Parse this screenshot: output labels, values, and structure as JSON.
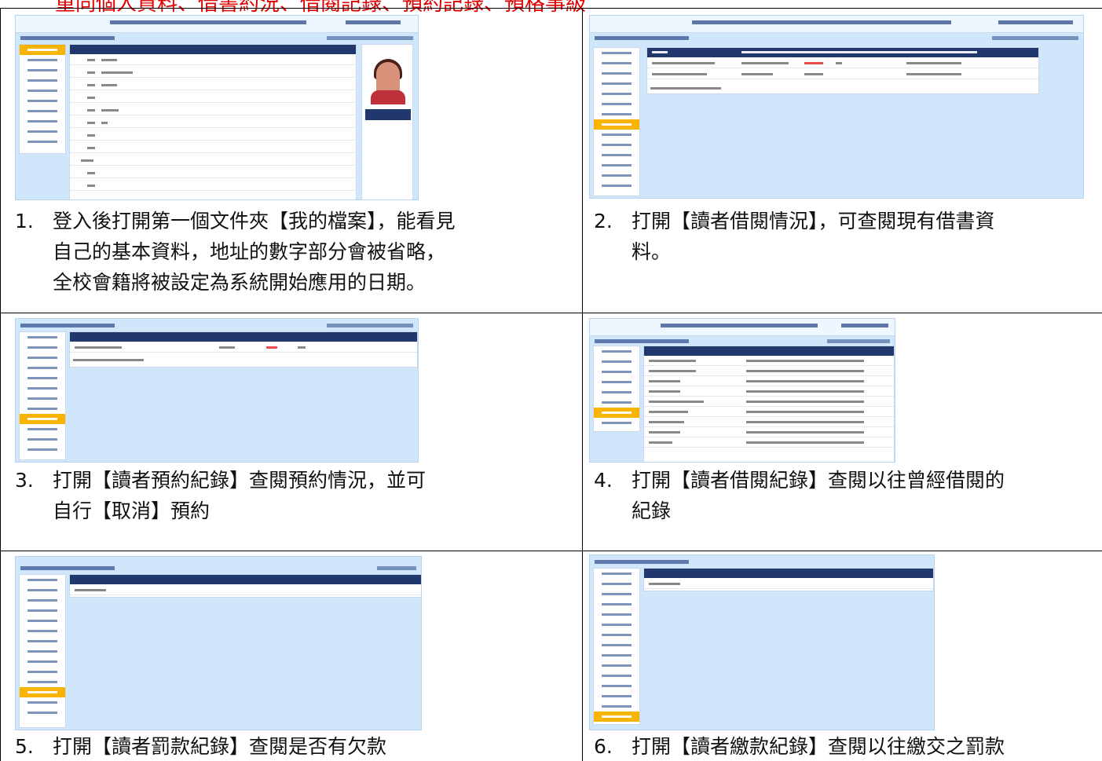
{
  "page": {
    "banner": "重同個人資料、借書約況、借閱記錄、預約記錄、預格事級"
  },
  "steps": [
    {
      "num": "1.",
      "lines": [
        "登入後打開第一個文件夾【我的檔案】，能看見",
        "自己的基本資料，地址的數字部分會被省略，",
        "全校會籍將被設定為系統開始應用的日期。"
      ]
    },
    {
      "num": "2.",
      "lines": [
        "打開【讀者借閱情況】，可查閱現有借書資",
        "料。"
      ]
    },
    {
      "num": "3.",
      "lines": [
        "打開【讀者預約紀錄】查閱預約情況，並可",
        "自行【取消】預約"
      ]
    },
    {
      "num": "4.",
      "lines": [
        "打開【讀者借閱紀錄】查閱以往曾經借閱的",
        "紀錄"
      ]
    },
    {
      "num": "5.",
      "lines": [
        "打開【讀者罰款紀錄】查閱是否有欠款"
      ]
    },
    {
      "num": "6.",
      "lines": [
        "打開【讀者繳款紀錄】查閱以往繳交之罰款"
      ]
    }
  ]
}
